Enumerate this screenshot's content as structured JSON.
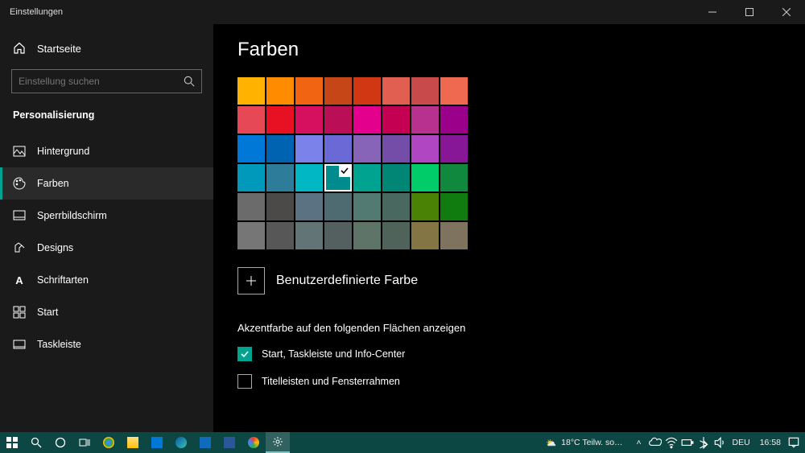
{
  "window": {
    "title": "Einstellungen"
  },
  "sidebar": {
    "home": "Startseite",
    "searchPlaceholder": "Einstellung suchen",
    "section": "Personalisierung",
    "items": [
      {
        "label": "Hintergrund"
      },
      {
        "label": "Farben"
      },
      {
        "label": "Sperrbildschirm"
      },
      {
        "label": "Designs"
      },
      {
        "label": "Schriftarten"
      },
      {
        "label": "Start"
      },
      {
        "label": "Taskleiste"
      }
    ]
  },
  "page": {
    "title": "Farben",
    "swatches": [
      "#ffb300",
      "#ff8c00",
      "#f06412",
      "#c64618",
      "#d23714",
      "#e15f51",
      "#c94a4a",
      "#ef6950",
      "#e74856",
      "#e81123",
      "#d6105e",
      "#ba0f57",
      "#e3008c",
      "#c30052",
      "#b9318e",
      "#9a0089",
      "#0078d7",
      "#0063b1",
      "#7b83eb",
      "#6b69d6",
      "#8764b8",
      "#744da9",
      "#b146c2",
      "#881798",
      "#0099bc",
      "#2d7d9a",
      "#00b7c3",
      "#008c8c",
      "#00a390",
      "#018574",
      "#00cc6a",
      "#10893e",
      "#6b6b6b",
      "#4c4a48",
      "#5b7282",
      "#4f6b72",
      "#537a72",
      "#486860",
      "#498205",
      "#107c10",
      "#767676",
      "#575757",
      "#637477",
      "#53605f",
      "#5f7468",
      "#50635a",
      "#847545",
      "#7e735f"
    ],
    "selectedIndex": 27,
    "customColor": "Benutzerdefinierte Farbe",
    "surfacesLabel": "Akzentfarbe auf den folgenden Flächen anzeigen",
    "cb1": "Start, Taskleiste und Info-Center",
    "cb2": "Titelleisten und Fensterrahmen"
  },
  "taskbar": {
    "weather": "18°C  Teilw. so…",
    "lang": "DEU",
    "time": "16:58"
  }
}
